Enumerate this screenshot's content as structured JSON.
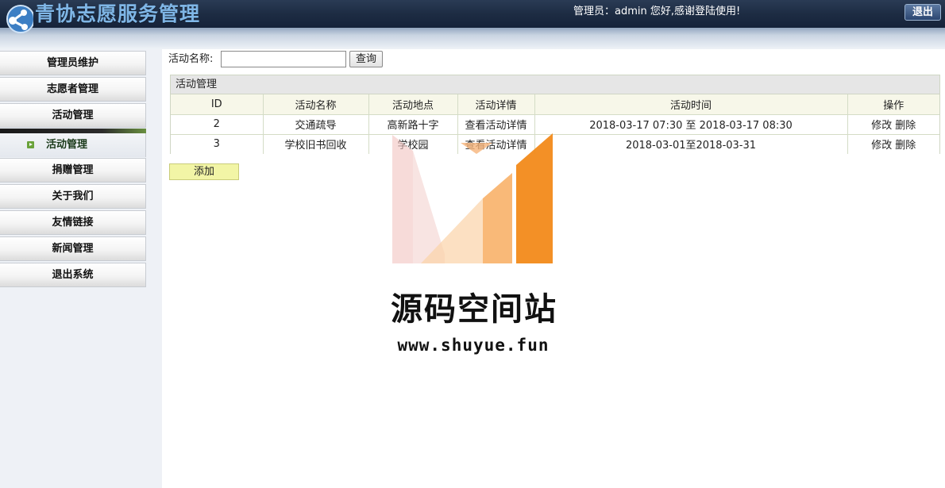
{
  "header": {
    "app_title": "青协志愿服务管理",
    "welcome_text": "管理员：admin 您好,感谢登陆使用!",
    "logout_label": "退出"
  },
  "sidebar": {
    "items": [
      {
        "label": "管理员维护"
      },
      {
        "label": "志愿者管理"
      },
      {
        "label": "活动管理"
      }
    ],
    "active_sub_item": {
      "label": "活动管理",
      "icon": "arrow-bullet-icon"
    },
    "items_after": [
      {
        "label": "捐赠管理"
      },
      {
        "label": "关于我们"
      },
      {
        "label": "友情链接"
      },
      {
        "label": "新闻管理"
      },
      {
        "label": "退出系统"
      }
    ]
  },
  "search": {
    "label": "活动名称:",
    "value": "",
    "button_label": "查询"
  },
  "panel": {
    "title": "活动管理",
    "columns": [
      "ID",
      "活动名称",
      "活动地点",
      "活动详情",
      "活动时间",
      "操作"
    ],
    "rows": [
      {
        "id": "2",
        "name": "交通疏导",
        "location": "高新路十字",
        "detail": "查看活动详情",
        "time": "2018-03-17 07:30 至 2018-03-17 08:30",
        "edit": "修改",
        "delete": "删除"
      },
      {
        "id": "3",
        "name": "学校旧书回收",
        "location": "学校园",
        "detail": "查看活动详情",
        "time": "2018-03-01至2018-03-31",
        "edit": "修改",
        "delete": "删除"
      }
    ]
  },
  "add_button_label": "添加",
  "watermark": {
    "name": "源码空间站",
    "url": "www.shuyue.fun"
  },
  "colors": {
    "header_bg": "#1d2c43",
    "title_blue": "#7fb6e6",
    "add_button_bg": "#f2f5a6",
    "table_header_bg": "#f7f7e9",
    "watermark_orange": "#f28a1a"
  }
}
